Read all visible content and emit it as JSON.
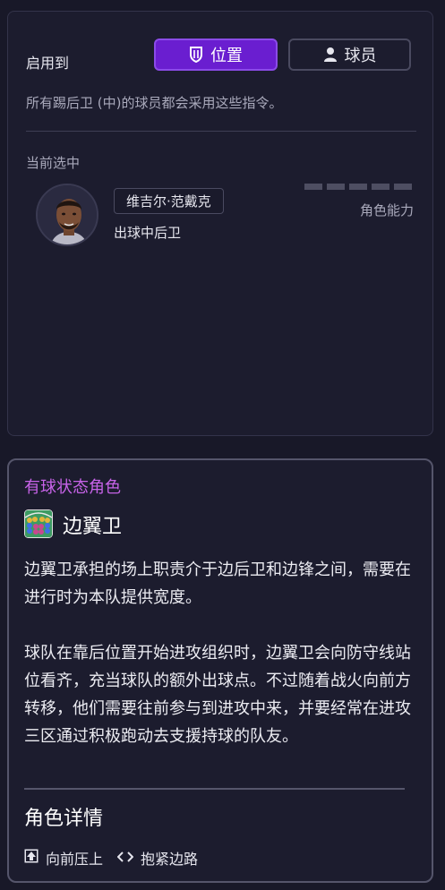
{
  "apply": {
    "label": "启用到",
    "options": [
      {
        "label": "位置",
        "selected": true,
        "icon": "shield-icon"
      },
      {
        "label": "球员",
        "selected": false,
        "icon": "person-icon"
      }
    ],
    "description": "所有踢后卫 (中)的球员都会采用这些指令。"
  },
  "current": {
    "label": "当前选中",
    "player_name": "维吉尔·范戴克",
    "player_role": "出球中后卫",
    "ability_label": "角色能力",
    "ability_level": 0
  },
  "role": {
    "type_label": "有球状态角色",
    "name": "边翼卫",
    "desc_1": "边翼卫承担的场上职责介于边后卫和边锋之间，需要在进行时为本队提供宽度。",
    "desc_2": "球队在靠后位置开始进攻组织时，边翼卫会向防守线站位看齐，充当球队的额外出球点。不过随着战火向前方转移，他们需要往前参与到进攻中来，并要经常在进攻三区通过积极跑动去支援持球的队友。",
    "details_title": "角色详情",
    "duties": [
      {
        "icon": "push-up-icon",
        "label": "向前压上"
      },
      {
        "icon": "hug-touchline-icon",
        "label": "抱紧边路"
      }
    ]
  },
  "colors": {
    "accent": "#6a1ed0",
    "role_type": "#c763e8",
    "background": "#181828"
  }
}
